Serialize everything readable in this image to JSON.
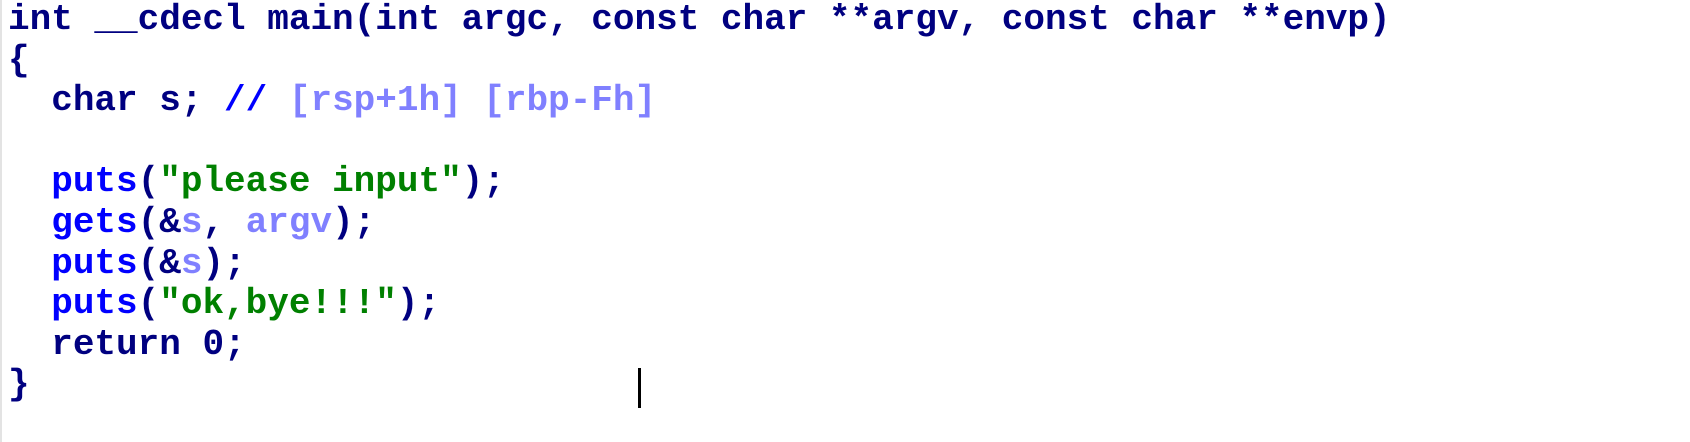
{
  "code": {
    "signature": "int __cdecl main(int argc, const char **argv, const char **envp)",
    "open_brace": "{",
    "decl": {
      "type_name": "char s; ",
      "comment_marker": "// ",
      "comment_text": "[rsp+1h] [rbp-Fh]"
    },
    "line_puts1": {
      "fn": "puts",
      "open": "(",
      "arg": "\"please input\"",
      "close": ");"
    },
    "line_gets": {
      "fn": "gets",
      "open": "(&",
      "arg1": "s",
      "sep": ", ",
      "arg2": "argv",
      "close": ");"
    },
    "line_puts2": {
      "fn": "puts",
      "open": "(&",
      "arg": "s",
      "close": ");"
    },
    "line_puts3": {
      "fn": "puts",
      "open": "(",
      "arg": "\"ok,bye!!!\"",
      "close": ");"
    },
    "line_return": "return 0;",
    "close_brace": "}"
  },
  "colors": {
    "keyword": "#000080",
    "function": "#0000ff",
    "string": "#008000",
    "comment": "#0000ff",
    "local_var": "#8080ff"
  }
}
